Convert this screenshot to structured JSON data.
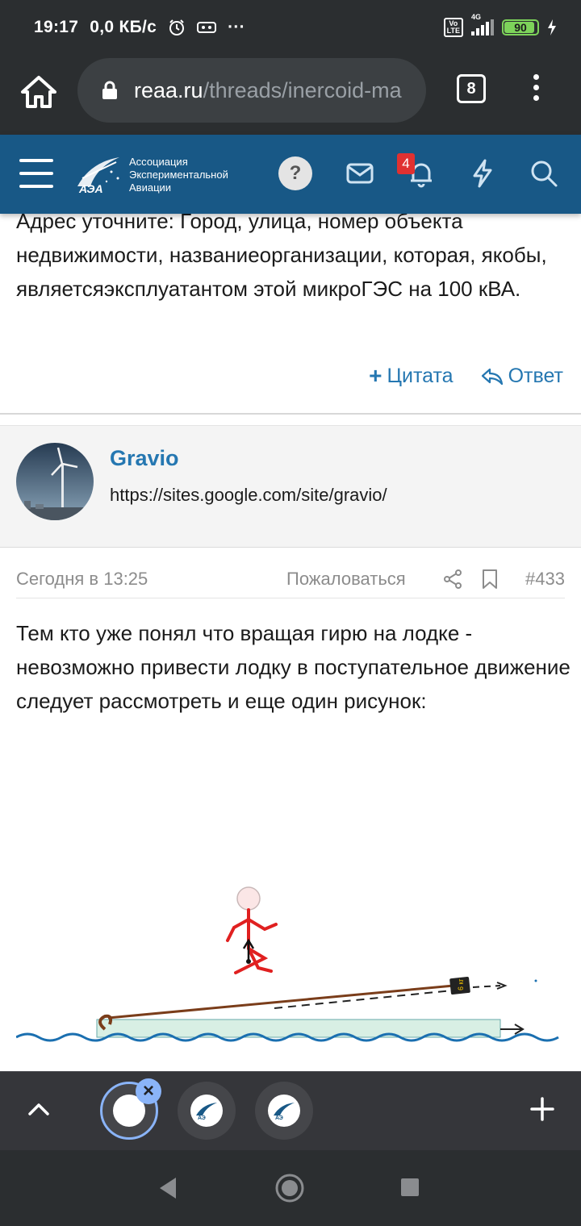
{
  "status_bar": {
    "time": "19:17",
    "speed": "0,0 КБ/с",
    "network": "4G",
    "volte": "Vo\nLTE",
    "battery": "90"
  },
  "browser": {
    "url_domain": "reaa.ru",
    "url_path": "/threads/inercoid-ma",
    "tab_count": "8"
  },
  "site_header": {
    "logo_abbr": "АЭА",
    "logo_line1": "Ассоциация",
    "logo_line2": "Экспериментальной",
    "logo_line3": "Авиации",
    "help_label": "?",
    "notification_count": "4"
  },
  "prev_post": {
    "text": "Адрес уточните: Город, улица, номер объекта недвижимости, названиеорганизации, которая, якобы, являетсяэксплуатантом этой микроГЭС на 100 кВА.",
    "quote_label": "Цитата",
    "reply_label": "Ответ"
  },
  "post": {
    "username": "Gravio",
    "user_site": "https://sites.google.com/site/gravio/",
    "date": "Сегодня в 13:25",
    "report_label": "Пожаловаться",
    "post_number": "#433",
    "text": "Тем кто уже понял что вращая гирю на лодке - невозможно привести лодку в поступательное движение следует рассмотреть и еще один рисунок:",
    "figure_weight_label": "6 кг"
  },
  "tab_bar": {
    "tab_logo": "АЭ"
  },
  "colors": {
    "accent": "#185886",
    "link": "#2577b1",
    "browser_dark": "#2b2e30",
    "boat": "#d8efe4",
    "water": "#1a6fb0",
    "rope": "#7a3d1a",
    "figure_red": "#e02020"
  }
}
